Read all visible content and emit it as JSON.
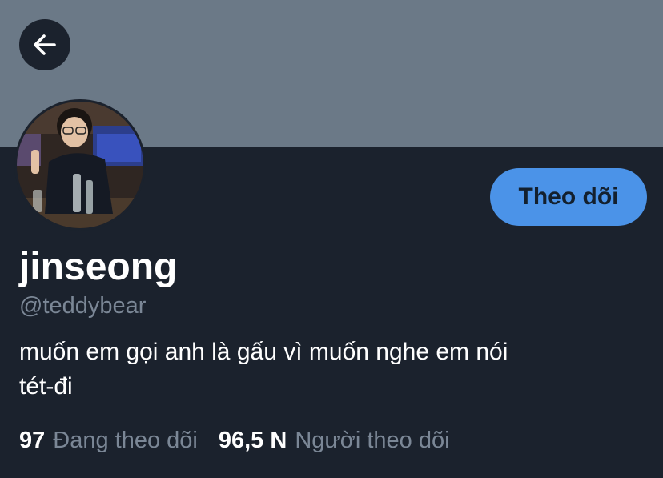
{
  "header": {
    "back_icon": "arrow-left-icon"
  },
  "profile": {
    "display_name": "jinseong",
    "handle": "@teddybear",
    "bio_line1": "muốn em gọi anh là gấu vì muốn nghe em nói",
    "bio_line2": "tét-đi",
    "follow_label": "Theo dõi",
    "following_count": "97",
    "following_label": "Đang theo dõi",
    "followers_count": "96,5 N",
    "followers_label": "Người theo dõi"
  },
  "colors": {
    "background": "#1b222d",
    "banner": "#6b7987",
    "accent": "#4b93e8",
    "secondary_text": "#7b8796"
  }
}
